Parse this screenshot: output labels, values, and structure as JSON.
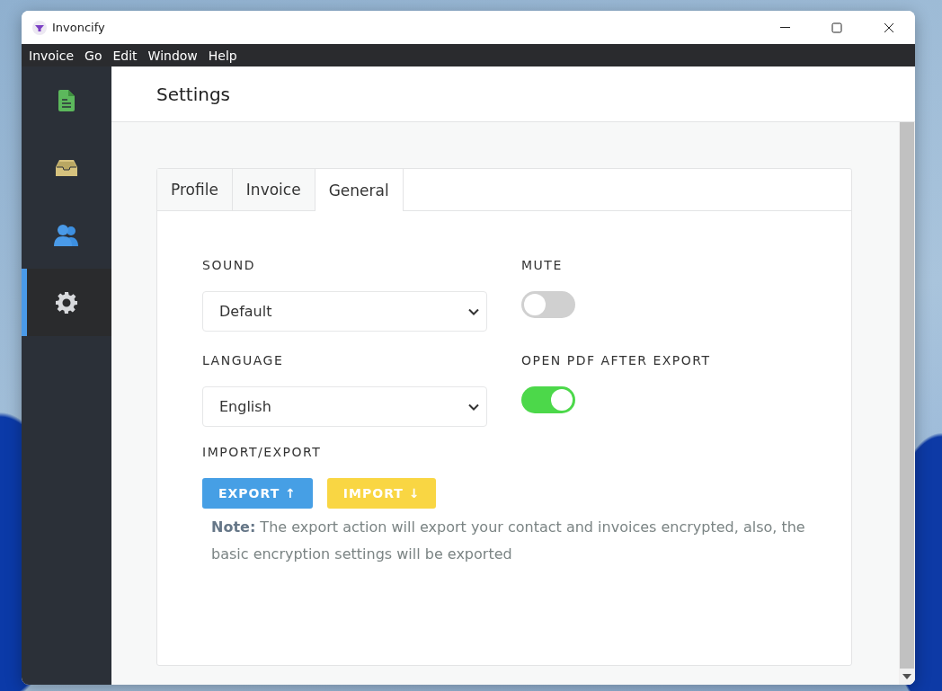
{
  "window": {
    "title": "Invoncify"
  },
  "menu": [
    {
      "label": "Invoice"
    },
    {
      "label": "Go"
    },
    {
      "label": "Edit"
    },
    {
      "label": "Window"
    },
    {
      "label": "Help"
    }
  ],
  "sidebar": {
    "items": [
      {
        "kind": "invoices",
        "selected": false
      },
      {
        "kind": "inbox",
        "selected": false
      },
      {
        "kind": "contacts",
        "selected": false
      },
      {
        "kind": "settings",
        "selected": true
      }
    ]
  },
  "page": {
    "title": "Settings"
  },
  "tabs": [
    {
      "label": "Profile",
      "selected": false
    },
    {
      "label": "Invoice",
      "selected": false
    },
    {
      "label": "General",
      "selected": true
    }
  ],
  "settings": [
    {
      "kind": "select",
      "label": "SOUND",
      "value": "Default"
    },
    {
      "kind": "toggle",
      "label": "MUTE",
      "on": false
    },
    {
      "kind": "select",
      "label": "LANGUAGE",
      "value": "English"
    },
    {
      "kind": "toggle",
      "label": "OPEN PDF AFTER EXPORT",
      "on": true
    }
  ],
  "import_export": {
    "label": "IMPORT/EXPORT",
    "buttons": [
      {
        "kind": "export",
        "label": "EXPORT ↑"
      },
      {
        "kind": "import",
        "label": "IMPORT ↓"
      }
    ],
    "note": "**Note:** The export action will export your contact and invoices encrypted, also, the basic encryption settings will be exported"
  }
}
